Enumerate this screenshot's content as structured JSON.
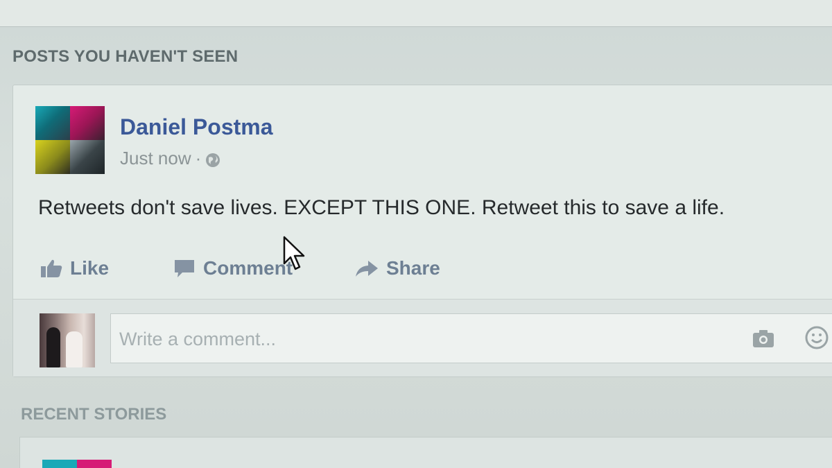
{
  "feed": {
    "section_unseen": "POSTS YOU HAVEN'T SEEN",
    "section_recent": "RECENT STORIES"
  },
  "post": {
    "author": "Daniel Postma",
    "timestamp": "Just now",
    "separator": "·",
    "privacy_icon": "globe-icon",
    "text": "Retweets don't save lives. EXCEPT THIS ONE. Retweet this to save a life."
  },
  "actions": {
    "like_label": "Like",
    "comment_label": "Comment",
    "share_label": "Share"
  },
  "comment_box": {
    "placeholder": "Write a comment...",
    "value": ""
  },
  "colors": {
    "link_blue": "#3b5998",
    "action_gray": "#6d7f93",
    "text": "#262a2c"
  }
}
